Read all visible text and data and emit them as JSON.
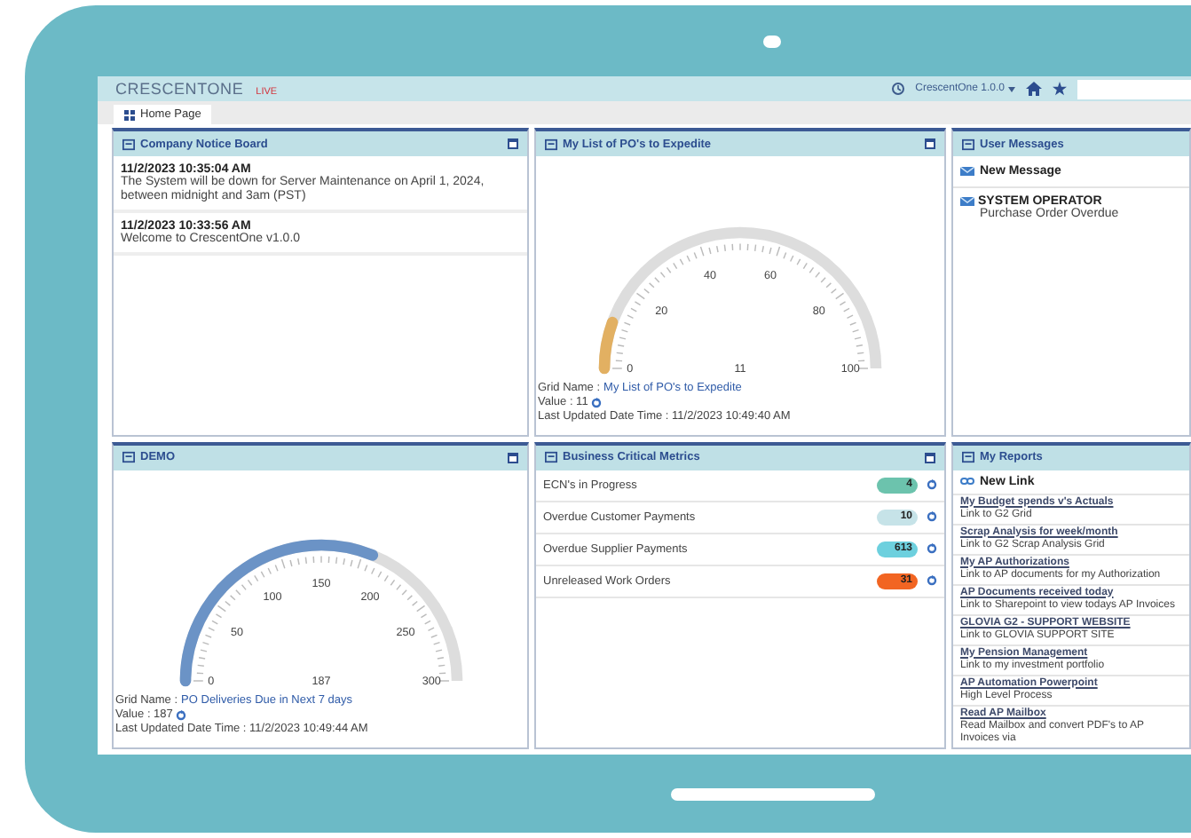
{
  "header": {
    "logo": "CRESCENTONE",
    "logo_suffix": "LIVE",
    "version_menu": "CrescentOne 1.0.0"
  },
  "tabs": [
    {
      "label": "Home Page",
      "selected": true
    }
  ],
  "panels": [
    {
      "kind": "notices",
      "title": "Company Notice Board",
      "notices": [
        {
          "time": "11/2/2023 10:35:04 AM",
          "text": "The System will be down for Server Maintenance on April 1, 2024, between midnight and 3am (PST)"
        },
        {
          "time": "11/2/2023 10:33:56 AM",
          "text": "Welcome to CrescentOne v1.0.0"
        }
      ]
    },
    {
      "kind": "gauge",
      "title": "My List of PO's to Expedite",
      "scale": [
        "0",
        "20",
        "40",
        "60",
        "80",
        "100"
      ],
      "center_value": "11",
      "color": "#e2b062",
      "grid_name_label": "Grid Name :",
      "grid_name": "My List of PO's to Expedite",
      "value_label": "Value : 11",
      "updated": "Last Updated Date Time : 11/2/2023 10:49:40 AM"
    },
    {
      "kind": "messages",
      "title": "User Messages",
      "new_label": "New Message",
      "messages": [
        {
          "sender": "SYSTEM OPERATOR",
          "subject": "Purchase Order Overdue"
        }
      ]
    },
    {
      "kind": "gauge",
      "title": "DEMO",
      "scale": [
        "0",
        "50",
        "100",
        "150",
        "200",
        "250",
        "300"
      ],
      "center_value": "187",
      "color": "#6b93c6",
      "grid_name_label": "Grid Name :",
      "grid_name": "PO Deliveries Due in Next 7 days",
      "value_label": "Value : 187",
      "updated": "Last Updated Date Time : 11/2/2023 10:49:44 AM"
    },
    {
      "kind": "metrics",
      "title": "Business Critical Metrics",
      "metrics": [
        {
          "label": "ECN's in Progress",
          "count": "4",
          "color": "#6cc3ad"
        },
        {
          "label": "Overdue Customer Payments",
          "count": "10",
          "color": "#c6e3e8"
        },
        {
          "label": "Overdue Supplier Payments",
          "count": "613",
          "color": "#6dd0de"
        },
        {
          "label": "Unreleased Work Orders",
          "count": "31",
          "color": "#f26522"
        }
      ]
    },
    {
      "kind": "links",
      "title": "My Reports",
      "new_label": "New Link",
      "links": [
        {
          "title": "My Budget spends v's Actuals",
          "description": "Link to G2 Grid"
        },
        {
          "title": "Scrap Analysis for week/month",
          "description": "Link to G2 Scrap Analysis Grid"
        },
        {
          "title": "My AP Authorizations",
          "description": "Link to AP documents for my Authorization"
        },
        {
          "title": "AP Documents received today",
          "description": "Link to Sharepoint to view todays AP Invoices"
        },
        {
          "title": "GLOVIA G2 - SUPPORT WEBSITE",
          "description": "Link to GLOVIA SUPPORT SITE"
        },
        {
          "title": "My Pension Management",
          "description": "Link to my investment portfolio"
        },
        {
          "title": "AP Automation Powerpoint",
          "description": "High Level Process"
        },
        {
          "title": "Read AP Mailbox",
          "description": "Read Mailbox and convert PDF's to AP Invoices via"
        }
      ]
    }
  ]
}
